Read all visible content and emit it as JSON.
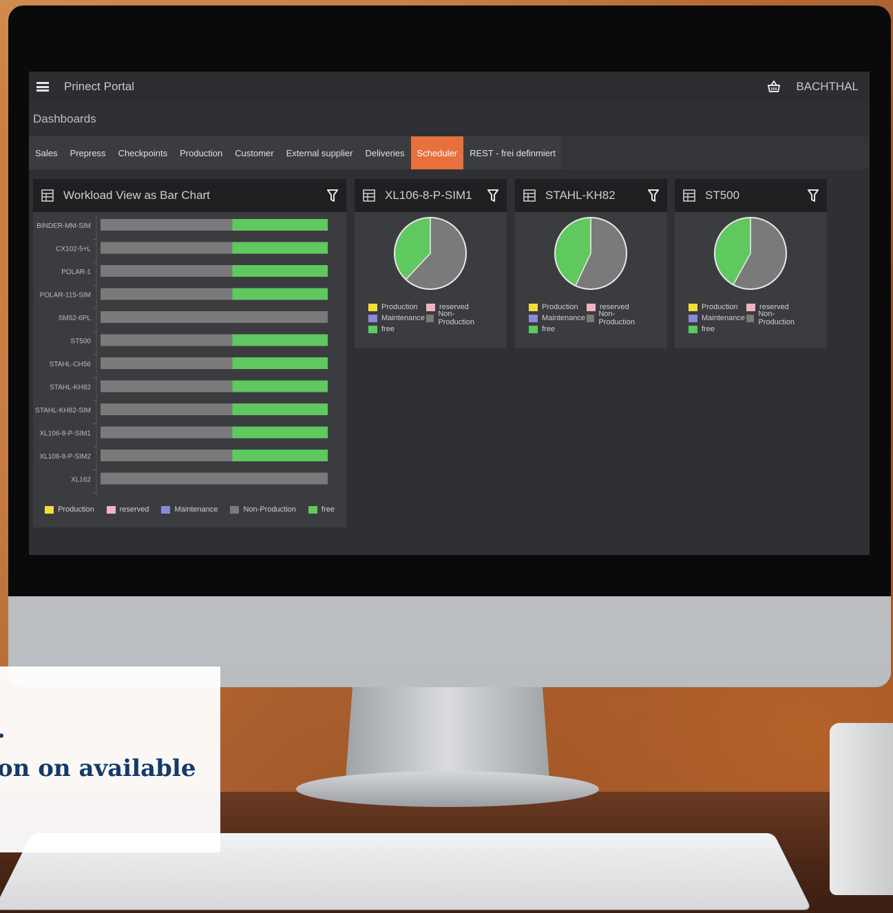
{
  "app": {
    "title": "Prinect Portal",
    "user": "BACHTHAL",
    "section": "Dashboards"
  },
  "icons": {
    "menu": "hamburger-icon",
    "basket": "basket-icon",
    "table": "table-icon",
    "filter": "filter-icon"
  },
  "tabs": [
    {
      "label": "Sales",
      "active": false
    },
    {
      "label": "Prepress",
      "active": false
    },
    {
      "label": "Checkpoints",
      "active": false
    },
    {
      "label": "Production",
      "active": false
    },
    {
      "label": "Customer",
      "active": false
    },
    {
      "label": "External supplier",
      "active": false
    },
    {
      "label": "Deliveries",
      "active": false
    },
    {
      "label": "Scheduler",
      "active": true
    },
    {
      "label": "REST - frei definmiert",
      "active": false
    }
  ],
  "colors": {
    "production": "#f2de3a",
    "reserved": "#f2b3c0",
    "maintenance": "#8a8ad6",
    "non_production": "#7a7a7a",
    "free": "#5fc85f",
    "accent": "#e8703d"
  },
  "legend": {
    "production": "Production",
    "reserved": "reserved",
    "maintenance": "Maintenance",
    "non_production": "Non-Production",
    "free": "free"
  },
  "workload_widget": {
    "title": "Workload View as Bar Chart"
  },
  "chart_data": [
    {
      "type": "bar",
      "orientation": "horizontal",
      "stacked": true,
      "categories": [
        "BINDER-MM-SIM",
        "CX102-5+L",
        "POLAR-1",
        "POLAR-115-SIM",
        "SM52-6PL",
        "ST500",
        "STAHL-CH56",
        "STAHL-KH82",
        "STAHL-KH82-SIM",
        "XL106-8-P-SIM1",
        "XL106-8-P-SIM2",
        "XL162"
      ],
      "series": [
        {
          "name": "Non-Production",
          "values": [
            58,
            58,
            58,
            58,
            100,
            58,
            58,
            58,
            58,
            58,
            58,
            100
          ]
        },
        {
          "name": "free",
          "values": [
            42,
            42,
            42,
            42,
            0,
            42,
            42,
            42,
            42,
            42,
            42,
            0
          ]
        }
      ],
      "legend_position": "bottom"
    },
    {
      "type": "pie",
      "title": "XL106-8-P-SIM1",
      "slices": [
        {
          "name": "Non-Production",
          "value": 62
        },
        {
          "name": "free",
          "value": 38
        }
      ]
    },
    {
      "type": "pie",
      "title": "STAHL-KH82",
      "slices": [
        {
          "name": "Non-Production",
          "value": 57
        },
        {
          "name": "free",
          "value": 43
        }
      ]
    },
    {
      "type": "pie",
      "title": "ST500",
      "slices": [
        {
          "name": "Non-Production",
          "value": 58
        },
        {
          "name": "free",
          "value": 42
        }
      ]
    }
  ],
  "caption": {
    "dot": ".",
    "text": "on on available"
  }
}
